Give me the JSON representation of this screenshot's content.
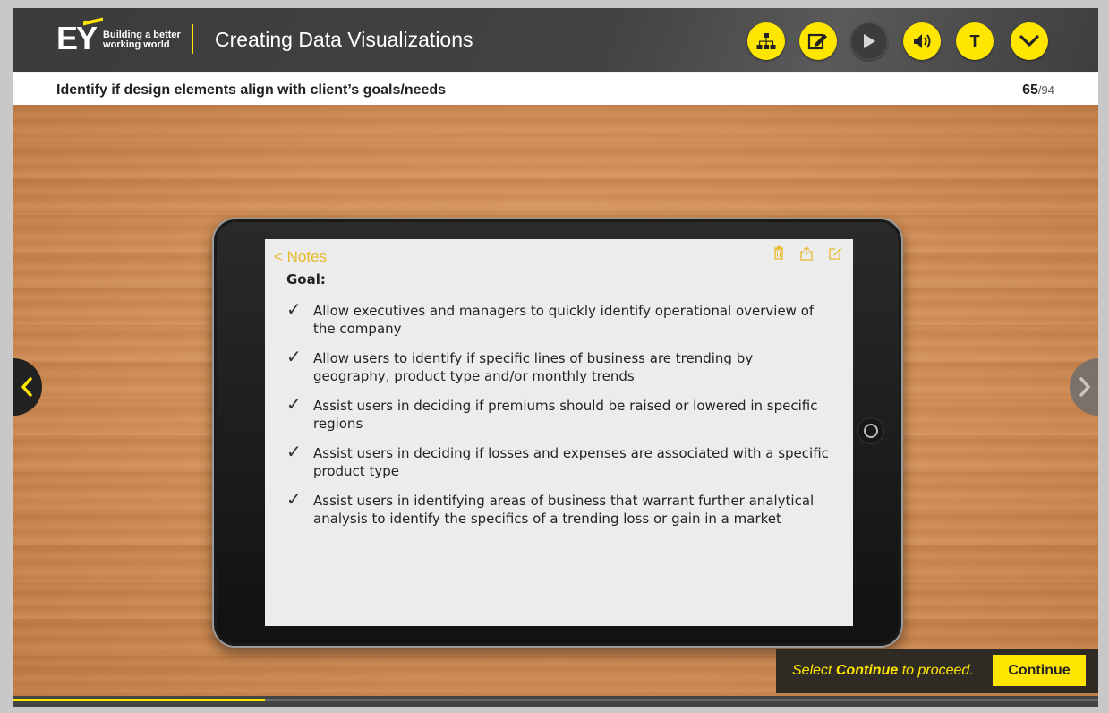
{
  "header": {
    "logo_text": "EY",
    "tagline_line1": "Building a better",
    "tagline_line2": "working world",
    "course_title": "Creating Data Visualizations",
    "toolbar": [
      {
        "icon": "sitemap-icon"
      },
      {
        "icon": "notes-edit-icon"
      },
      {
        "icon": "play-icon"
      },
      {
        "icon": "volume-icon"
      },
      {
        "icon": "text-icon",
        "label": "T"
      },
      {
        "icon": "chevron-down-icon"
      }
    ]
  },
  "subheader": {
    "slide_title": "Identify if design elements align with client’s goals/needs",
    "page_current": "65",
    "page_total": "/94"
  },
  "notes": {
    "back_label": "< Notes",
    "goal_label": "Goal:",
    "goals": [
      "Allow executives and managers to quickly identify operational overview of the company",
      "Allow users to identify if specific lines of business are trending by geography, product type and/or monthly trends",
      "Assist users in deciding if premiums should be raised or lowered in specific regions",
      "Assist users in deciding if losses and expenses are associated with a specific product type",
      "Assist users in identifying areas of business that warrant further analytical analysis to identify the specifics of a trending loss or gain in a market"
    ]
  },
  "continue": {
    "prompt_prefix": "Select ",
    "prompt_emphasis": "Continue",
    "prompt_suffix": " to proceed.",
    "button_label": "Continue"
  },
  "progress": {
    "fraction": 0.2315
  },
  "colors": {
    "accent": "#ffe600",
    "header_bg": "#3f3f3f",
    "notes_accent": "#e8b92a"
  }
}
